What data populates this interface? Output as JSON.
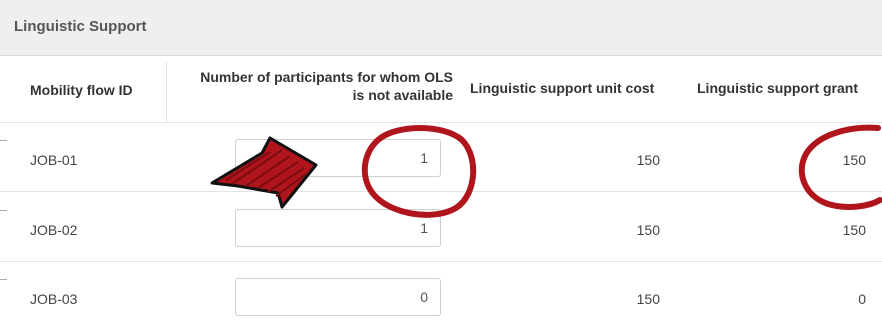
{
  "section": {
    "title": "Linguistic Support"
  },
  "columns": {
    "mobility_flow_id": "Mobility flow ID",
    "participants_line1": "Number of participants for whom OLS",
    "participants_line2": "is not available",
    "unit_cost": "Linguistic support unit cost",
    "grant": "Linguistic support grant"
  },
  "rows": [
    {
      "id": "JOB-01",
      "participants": "1",
      "unit_cost": "150",
      "grant": "150"
    },
    {
      "id": "JOB-02",
      "participants": "1",
      "unit_cost": "150",
      "grant": "150"
    },
    {
      "id": "JOB-03",
      "participants": "0",
      "unit_cost": "150",
      "grant": "0"
    }
  ],
  "colors": {
    "annotation": "#b0151c",
    "header_bg": "#efefef"
  },
  "annotations": {
    "arrow_icon": "red-arrow-icon",
    "circle_icon": "red-circle-icon"
  }
}
